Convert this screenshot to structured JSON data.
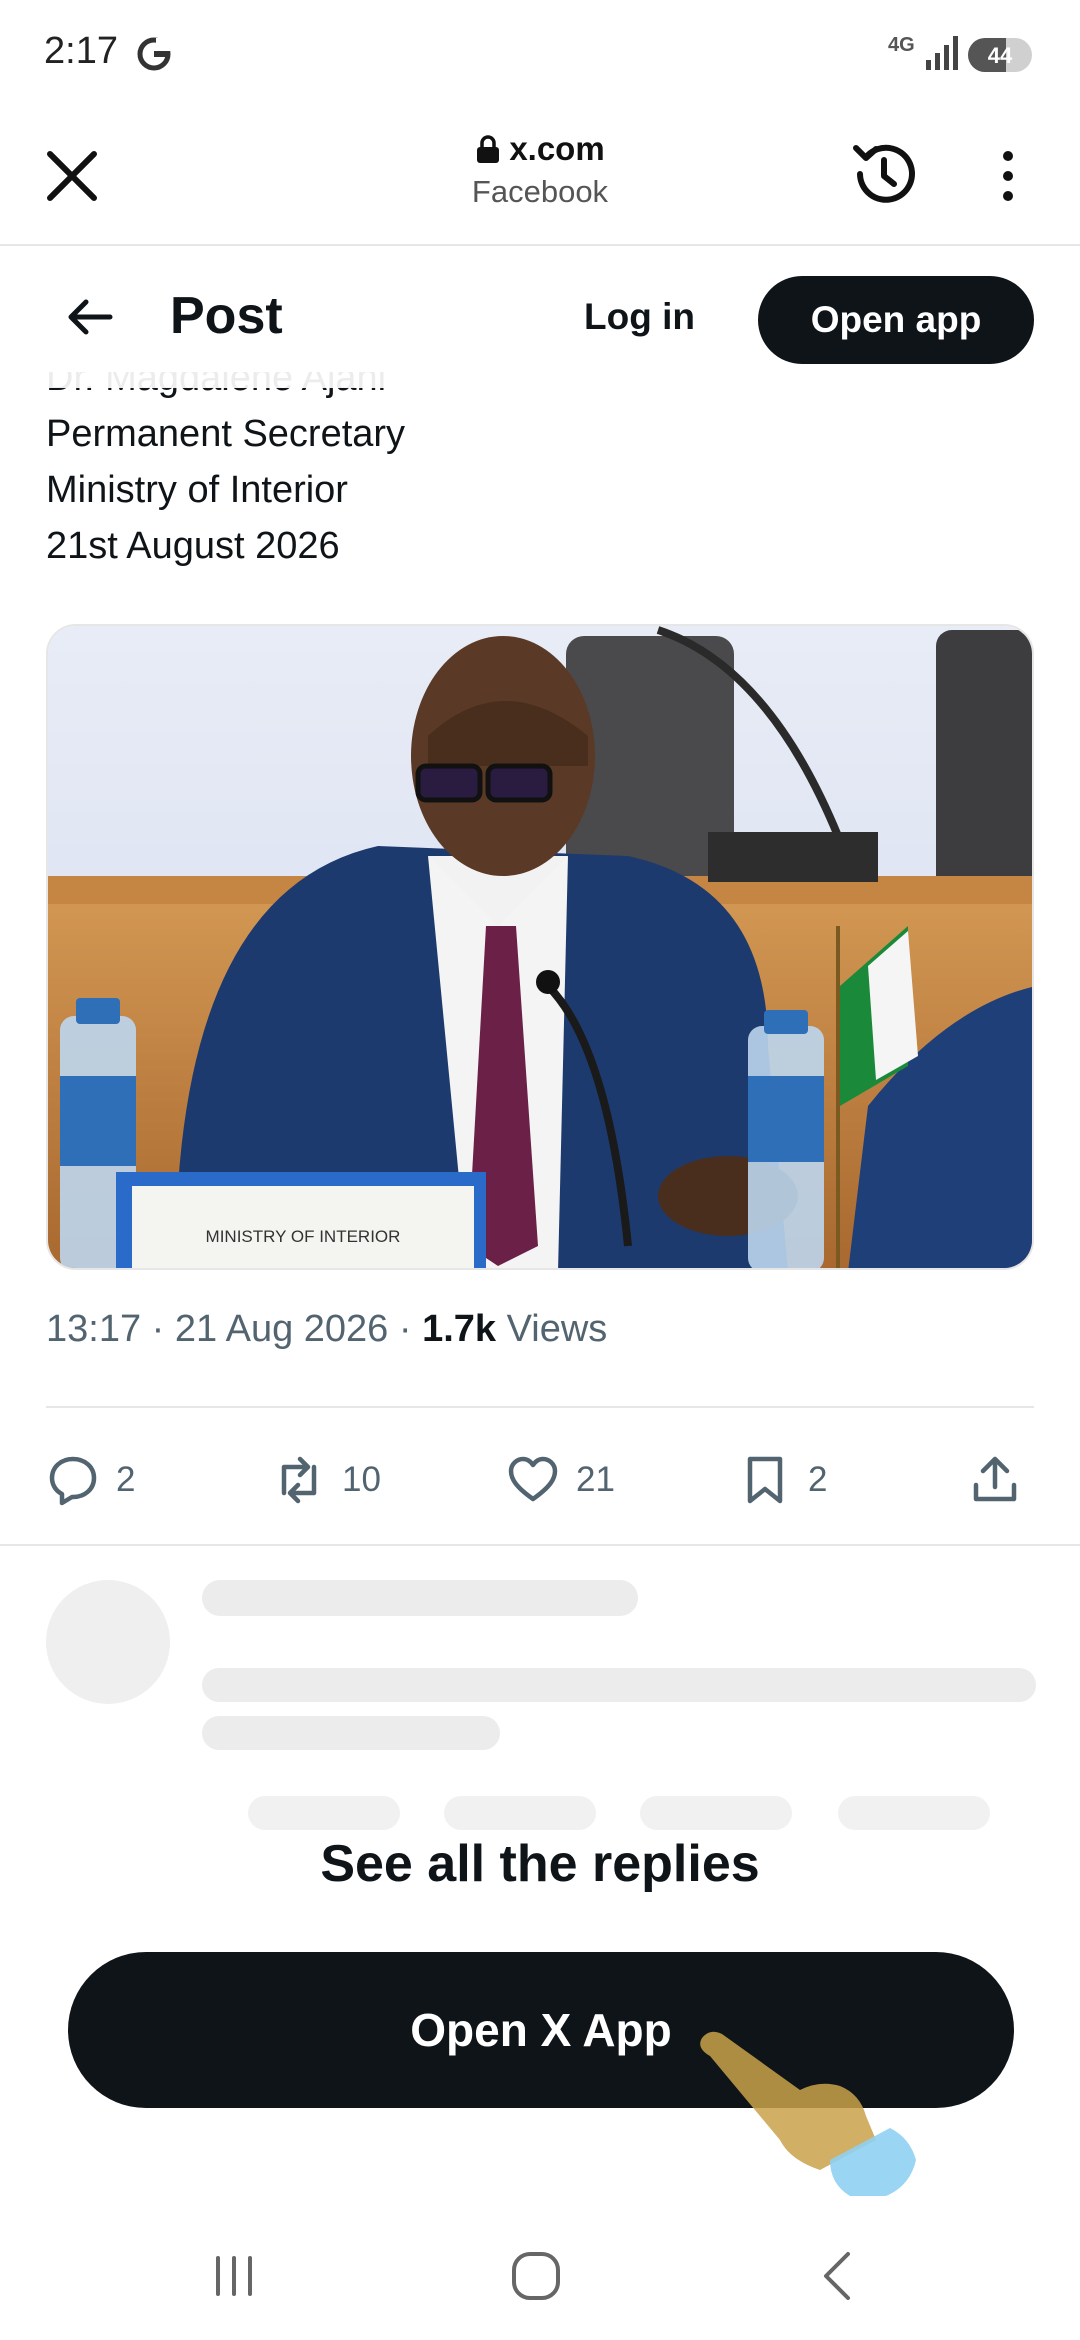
{
  "status_bar": {
    "time": "2:17",
    "network": "4G",
    "battery": "44"
  },
  "browser": {
    "domain": "x.com",
    "subtitle": "Facebook"
  },
  "header": {
    "title": "Post",
    "login": "Log in",
    "open_app": "Open app"
  },
  "post": {
    "lines": [
      "Dr. Magdalene Ajani",
      "Permanent Secretary",
      "Ministry of Interior",
      "21st August 2026"
    ],
    "photo": {
      "plaque": "MINISTRY OF INTERIOR"
    },
    "time": "13:17",
    "date": "21 Aug 2026",
    "views_count": "1.7k",
    "views_label": "Views"
  },
  "actions": {
    "replies": "2",
    "reposts": "10",
    "likes": "21",
    "bookmarks": "2"
  },
  "cta": {
    "heading": "See all the replies",
    "button": "Open X App"
  },
  "colors": {
    "primary": "#0f1419",
    "secondary_text": "#536471",
    "divider": "#e6e6e6"
  }
}
